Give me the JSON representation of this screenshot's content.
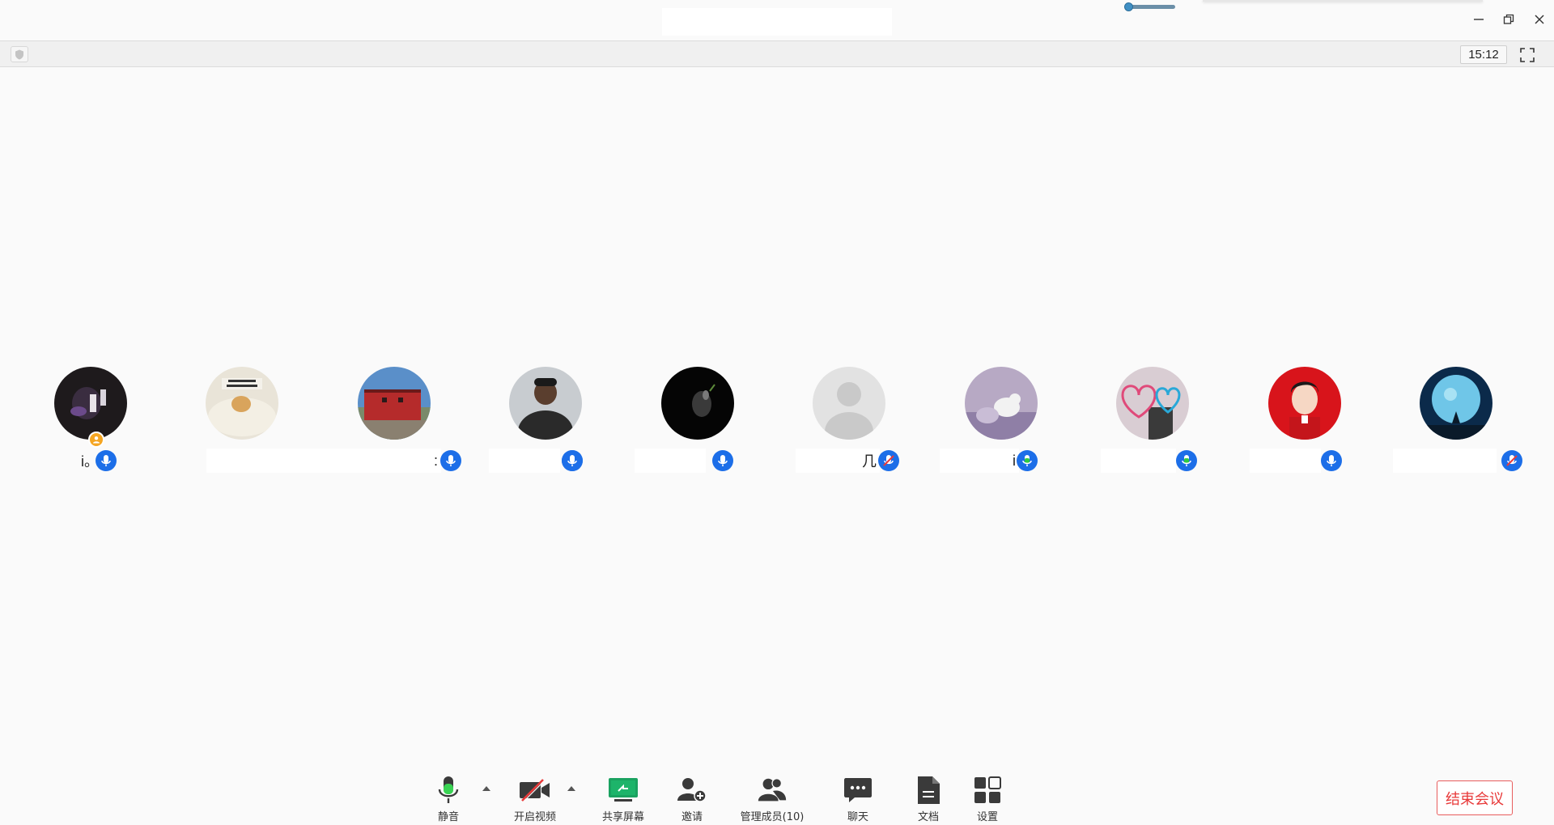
{
  "window": {
    "controls": {
      "minimize_icon": "minimize-icon",
      "restore_icon": "restore-icon",
      "close_icon": "close-icon"
    }
  },
  "volume": {
    "level": 0.05
  },
  "strip": {
    "timer": "15:12",
    "security_icon": "shield-icon",
    "fullscreen_icon": "fullscreen-icon"
  },
  "participants": [
    {
      "name": "i。",
      "host": true,
      "mic": "on"
    },
    {
      "name": ":",
      "host": false,
      "mic": "on"
    },
    {
      "name": "",
      "host": false,
      "mic": "on"
    },
    {
      "name": "",
      "host": false,
      "mic": "on"
    },
    {
      "name": "",
      "host": false,
      "mic": "on"
    },
    {
      "name": "几",
      "host": false,
      "mic": "muted"
    },
    {
      "name": "i",
      "host": false,
      "mic": "speaking"
    },
    {
      "name": "",
      "host": false,
      "mic": "speaking"
    },
    {
      "name": "",
      "host": false,
      "mic": "on"
    },
    {
      "name": "",
      "host": false,
      "mic": "muted"
    }
  ],
  "toolbar": {
    "mute": "静音",
    "video": "开启视频",
    "share": "共享屏幕",
    "invite": "邀请",
    "members": "管理成员(10)",
    "chat": "聊天",
    "docs": "文档",
    "settings": "设置",
    "end_meeting": "结束会议"
  },
  "colors": {
    "accent_blue": "#1c6ee8",
    "speaking_green": "#2ecc40",
    "end_red": "#e83a3a",
    "share_green": "#1aa260"
  }
}
